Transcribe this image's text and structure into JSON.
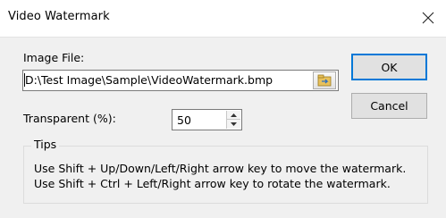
{
  "window": {
    "title": "Video Watermark"
  },
  "image_file": {
    "label": "Image File:",
    "value": "D:\\Test Image\\Sample\\VideoWatermark.bmp"
  },
  "transparent": {
    "label": "Transparent (%):",
    "value": "50"
  },
  "buttons": {
    "ok": "OK",
    "cancel": "Cancel"
  },
  "tips": {
    "title": "Tips",
    "lines": [
      "Use Shift + Up/Down/Left/Right arrow key to move the watermark.",
      "Use Shift + Ctrl + Left/Right arrow key to rotate the watermark."
    ]
  },
  "colors": {
    "default_button_border": "#0078d7",
    "dialog_background": "#f0f0f0"
  },
  "icons": {
    "close": "close-icon",
    "browse": "folder-icon",
    "spin_up": "up-arrow-icon",
    "spin_down": "down-arrow-icon"
  }
}
